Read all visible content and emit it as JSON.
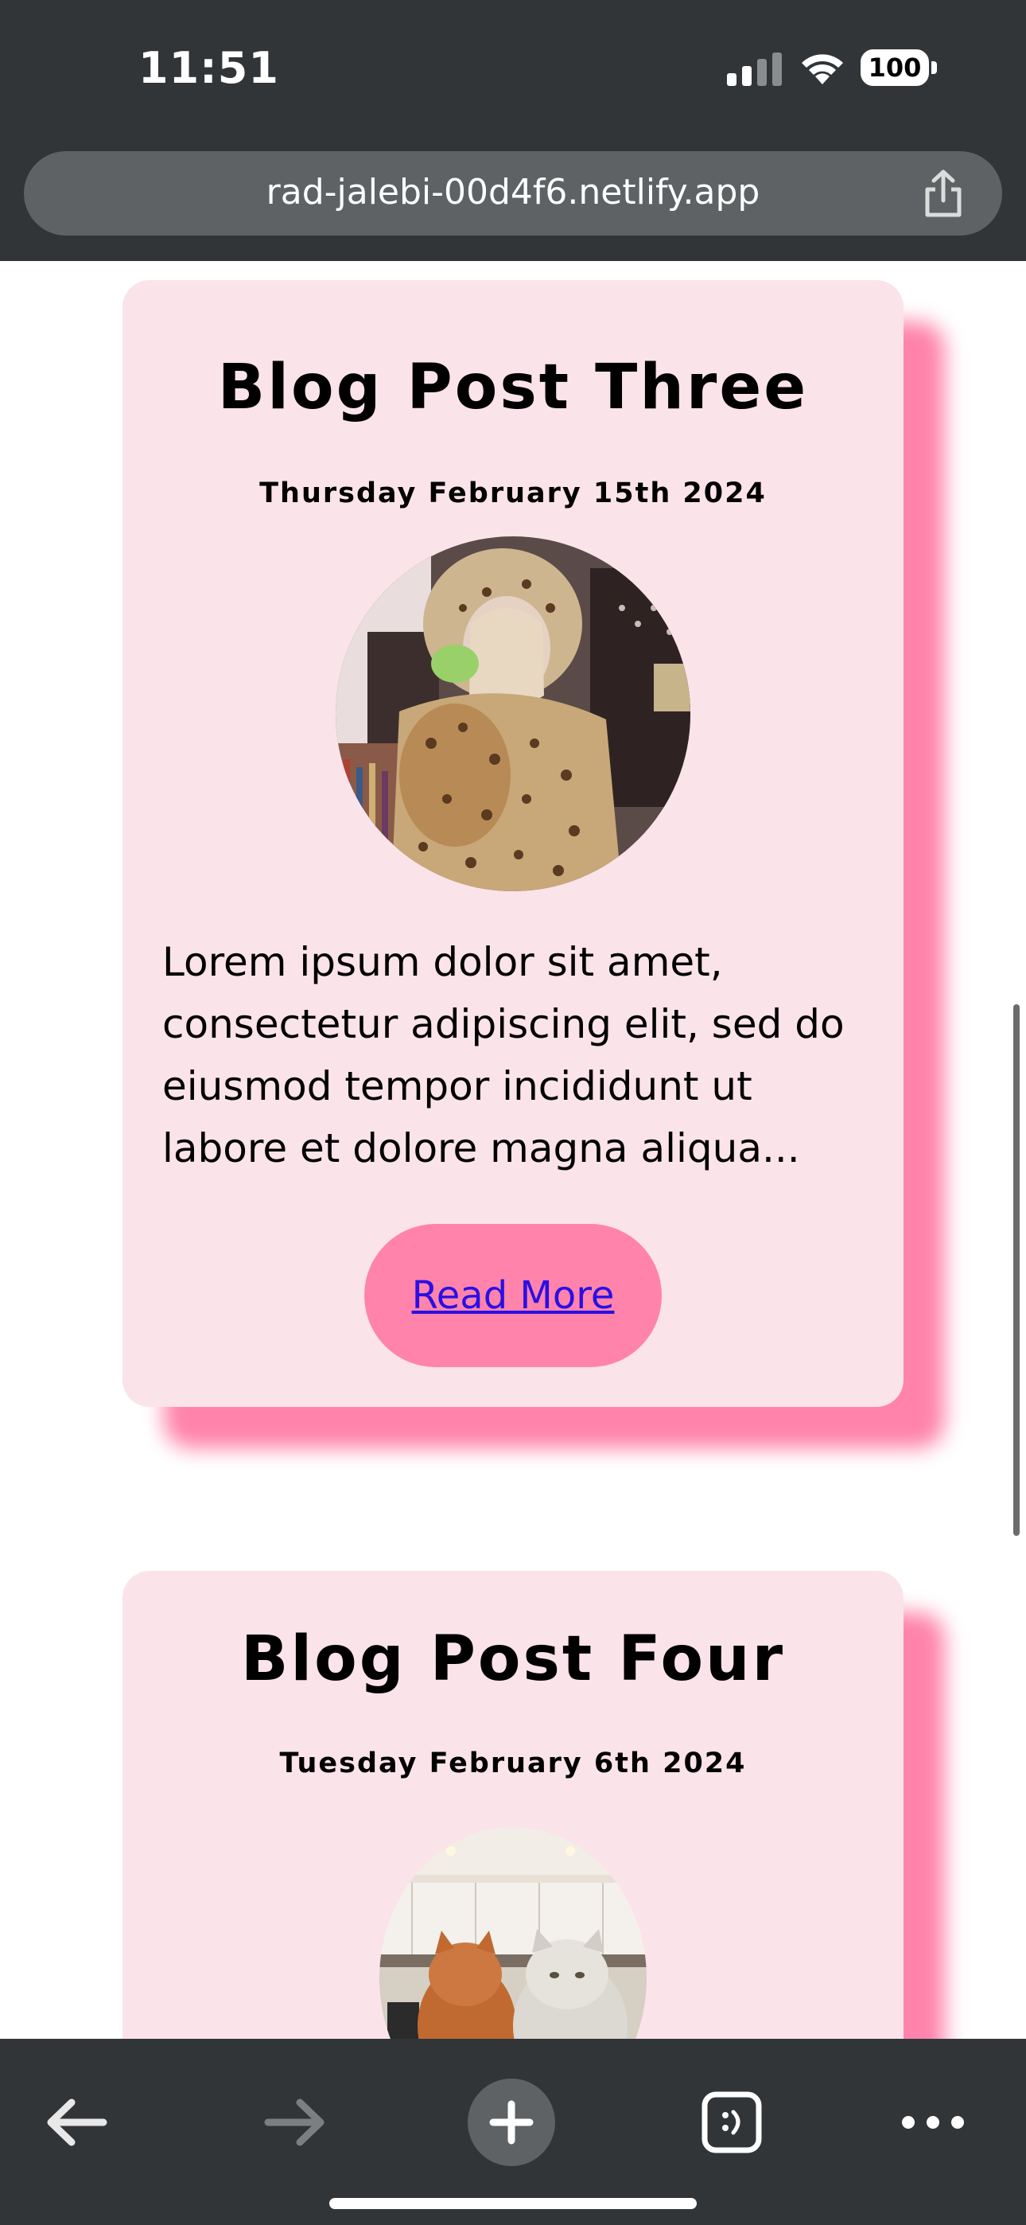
{
  "status_bar": {
    "time": "11:51",
    "battery_level": "100"
  },
  "browser": {
    "url": "rad-jalebi-00d4f6.netlify.app"
  },
  "posts": [
    {
      "title": "Blog Post Three",
      "date": "Thursday February 15th 2024",
      "excerpt": "Lorem ipsum dolor sit amet, consectetur adipiscing elit, sed do eiusmod tempor incididunt ut labore et dolore magna aliqua...",
      "read_more_label": "Read More",
      "photo": "person-in-leopard-fur-coat-holding-cat"
    },
    {
      "title": "Blog Post Four",
      "date": "Tuesday February 6th 2024",
      "photo": "two-fluffy-cats-in-kitchen"
    }
  ],
  "toolbar": {
    "icons": [
      "back-arrow-icon",
      "forward-arrow-icon",
      "plus-icon",
      "tabs-icon",
      "more-icon"
    ]
  },
  "colors": {
    "card_background": "#fbe3ea",
    "accent_pink": "#ff83aa",
    "browser_chrome": "#323538",
    "link": "#2a0fe6"
  }
}
